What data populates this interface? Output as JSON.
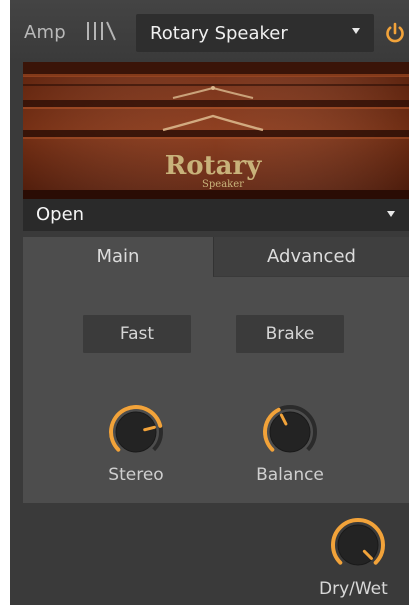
{
  "header": {
    "amp_label": "Amp",
    "bars_icon": "bars-icon",
    "preset": "Rotary Speaker",
    "power_icon": "power-icon"
  },
  "image": {
    "brand_text": "Rotary",
    "brand_subtext": "Speaker"
  },
  "mode_select": {
    "value": "Open"
  },
  "tabs": [
    {
      "label": "Main",
      "active": true
    },
    {
      "label": "Advanced",
      "active": false
    }
  ],
  "buttons": {
    "fast": "Fast",
    "brake": "Brake"
  },
  "knobs": {
    "stereo": {
      "label": "Stereo",
      "value": 0.78
    },
    "balance": {
      "label": "Balance",
      "value": 0.4
    },
    "dry_wet": {
      "label": "Dry/Wet",
      "value": 1.0
    }
  },
  "colors": {
    "accent": "#f2a33a",
    "panel": "#3a3a3a",
    "section": "#4d4d4d",
    "knob_body": "#232323"
  }
}
